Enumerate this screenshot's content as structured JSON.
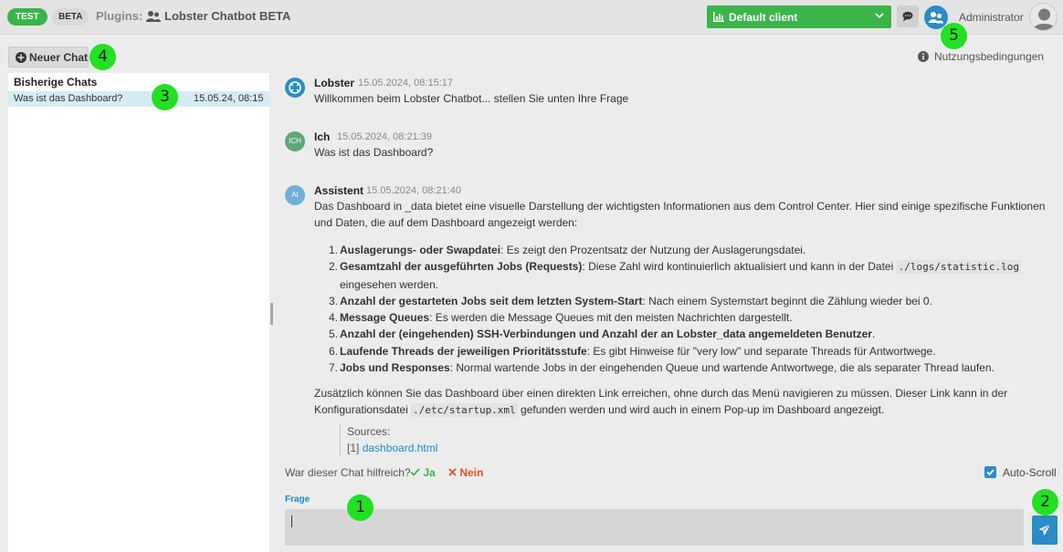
{
  "topbar": {
    "badge_test": "TEST",
    "badge_beta": "BETA",
    "plugins_label": "Plugins:",
    "plugin_name": "Lobster Chatbot BETA",
    "client_select": "Default client",
    "user_name": "Administrator"
  },
  "toolbar": {
    "new_chat_label": "Neuer Chat",
    "terms_label": "Nutzungsbedingungen"
  },
  "sidebar": {
    "title": "Bisherige Chats",
    "chats": [
      {
        "title": "Was ist das Dashboard?",
        "date": "15.05.24, 08:15"
      }
    ]
  },
  "messages": [
    {
      "author": "Lobster",
      "time": "15.05.2024, 08:15:17",
      "text": "Willkommen beim Lobster Chatbot... stellen Sie unten Ihre Frage"
    },
    {
      "author": "Ich",
      "avatar": "ICH",
      "time": "15.05.2024, 08:21:39",
      "text": "Was ist das Dashboard?"
    },
    {
      "author": "Assistent",
      "avatar": "AI",
      "time": "15.05.2024, 08:21:40",
      "intro": "Das Dashboard in _data bietet eine visuelle Darstellung der wichtigsten Informationen aus dem Control Center. Hier sind einige spezifische Funktionen und Daten, die auf dem Dashboard angezeigt werden:",
      "list": [
        {
          "num": "1.",
          "bold": "Auslagerungs- oder Swapdatei",
          "text": ": Es zeigt den Prozentsatz der Nutzung der Auslagerungsdatei."
        },
        {
          "num": "2.",
          "bold": "Gesamtzahl der ausgeführten Jobs (Requests)",
          "text": ": Diese Zahl wird kontinuierlich aktualisiert und kann in der Datei ",
          "code": "./logs/statistic.log",
          "text2": " eingesehen werden."
        },
        {
          "num": "3.",
          "bold": "Anzahl der gestarteten Jobs seit dem letzten System-Start",
          "text": ": Nach einem Systemstart beginnt die Zählung wieder bei 0."
        },
        {
          "num": "4.",
          "bold": "Message Queues",
          "text": ": Es werden die Message Queues mit den meisten Nachrichten dargestellt."
        },
        {
          "num": "5.",
          "bold": "Anzahl der (eingehenden) SSH-Verbindungen und Anzahl der an Lobster_data angemeldeten Benutzer",
          "text": "."
        },
        {
          "num": "6.",
          "bold": "Laufende Threads der jeweiligen Prioritätsstufe",
          "text": ": Es gibt Hinweise für \"very low\" und separate Threads für Antwortwege."
        },
        {
          "num": "7.",
          "bold": "Jobs und Responses",
          "text": ": Normal wartende Jobs in der eingehenden Queue und wartende Antwortwege, die als separater Thread laufen."
        }
      ],
      "outro_1": "Zusätzlich können Sie das Dashboard über einen direkten Link erreichen, ohne durch das Menü navigieren zu müssen. Dieser Link kann in der Konfigurationsdatei",
      "outro_code": "./etc/startup.xml",
      "outro_2": " gefunden werden und wird auch in einem Pop-up im Dashboard angezeigt.",
      "sources_label": "Sources:",
      "source_num": "[1]",
      "source_link": "dashboard.html"
    }
  ],
  "feedback": {
    "question": "War dieser Chat hilfreich?",
    "yes": "Ja",
    "no": "Nein",
    "autoscroll": "Auto-Scroll"
  },
  "input": {
    "label": "Frage",
    "value": ""
  },
  "markers": [
    "1",
    "2",
    "3",
    "4",
    "5"
  ],
  "colors": {
    "accent_green": "#3bb54a",
    "accent_blue": "#2a8dc4",
    "no_red": "#e05226",
    "marker_green": "#22e022"
  }
}
